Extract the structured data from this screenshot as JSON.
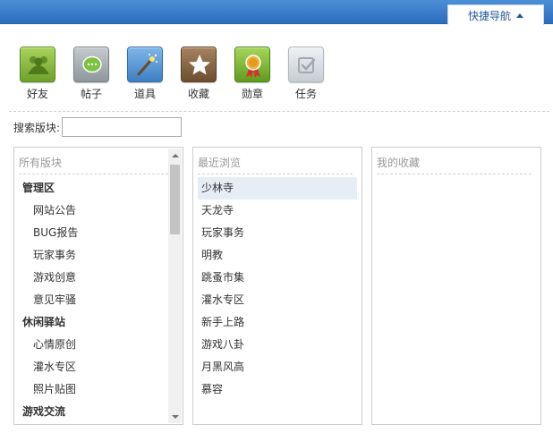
{
  "header": {
    "quick_nav_label": "快捷导航"
  },
  "toolbar": {
    "items": [
      {
        "label": "好友",
        "icon": "friends-icon"
      },
      {
        "label": "帖子",
        "icon": "chat-bubble-icon"
      },
      {
        "label": "道具",
        "icon": "magic-wand-icon"
      },
      {
        "label": "收藏",
        "icon": "star-icon"
      },
      {
        "label": "勋章",
        "icon": "medal-icon"
      },
      {
        "label": "任务",
        "icon": "checklist-icon"
      }
    ]
  },
  "search": {
    "label": "搜索版块:",
    "value": "",
    "placeholder": ""
  },
  "all_forums": {
    "title": "所有版块",
    "items": [
      {
        "label": "管理区",
        "type": "group"
      },
      {
        "label": "网站公告",
        "type": "child"
      },
      {
        "label": "BUG报告",
        "type": "child"
      },
      {
        "label": "玩家事务",
        "type": "child"
      },
      {
        "label": "游戏创意",
        "type": "child"
      },
      {
        "label": "意见牢骚",
        "type": "child"
      },
      {
        "label": "休闲驿站",
        "type": "group"
      },
      {
        "label": "心情原创",
        "type": "child"
      },
      {
        "label": "灌水专区",
        "type": "child"
      },
      {
        "label": "照片贴图",
        "type": "child"
      },
      {
        "label": "游戏交流",
        "type": "group"
      }
    ]
  },
  "recent": {
    "title": "最近浏览",
    "selected_index": 0,
    "items": [
      "少林寺",
      "天龙寺",
      "玩家事务",
      "明教",
      "跳蚤市集",
      "灌水专区",
      "新手上路",
      "游戏八卦",
      "月黑风高",
      "慕容"
    ]
  },
  "favorites": {
    "title": "我的收藏",
    "items": []
  },
  "colors": {
    "topbar": "#2b6cbc",
    "selected_row": "#e6edf4"
  }
}
